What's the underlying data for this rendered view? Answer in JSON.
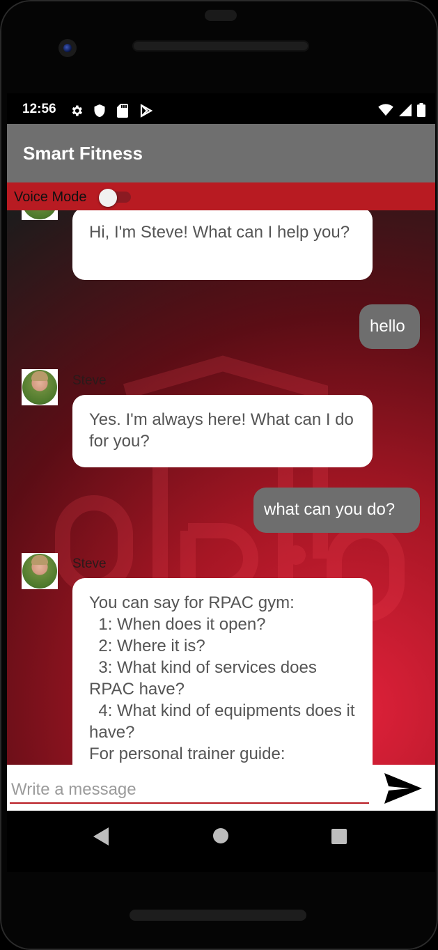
{
  "status_bar": {
    "time": "12:56",
    "left_icons": [
      "settings-icon",
      "shield-icon",
      "sd-card-icon",
      "play-store-icon"
    ],
    "right_icons": [
      "wifi-icon",
      "signal-icon",
      "battery-icon"
    ]
  },
  "app_bar": {
    "title": "Smart Fitness"
  },
  "voice_mode": {
    "label": "Voice Mode",
    "enabled": false
  },
  "messages": [
    {
      "from": "bot",
      "sender": "",
      "text": "Hi, I'm Steve! What can I help you?"
    },
    {
      "from": "user",
      "text": "hello"
    },
    {
      "from": "bot",
      "sender": "Steve",
      "text": "Yes. I'm always here! What can I do for you?"
    },
    {
      "from": "user",
      "text": "what can you do?"
    },
    {
      "from": "bot",
      "sender": "Steve",
      "text": "You can say for RPAC gym:\n  1: When does it open?\n  2: Where it is?\n  3: What kind of services does RPAC have?\n  4: What kind of equipments does it have?\nFor personal trainer guide:"
    }
  ],
  "composer": {
    "placeholder": "Write a message",
    "value": "",
    "send_icon": "send-icon"
  },
  "nav_bar": {
    "icons": [
      "back-icon",
      "home-icon",
      "recents-icon"
    ]
  },
  "colors": {
    "accent": "#b81b22",
    "appbar": "#6f6f6f",
    "user_bubble": "#6e6e6e"
  }
}
